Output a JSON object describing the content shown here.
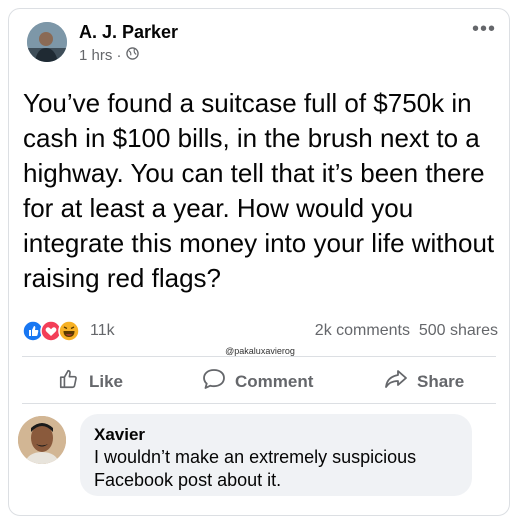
{
  "post": {
    "author": "A. J. Parker",
    "time": "1 hrs ·",
    "audience_icon": "globe-icon",
    "menu_icon": "more-options-icon",
    "text": "You’ve found a suitcase full of $750k in cash in $100 bills, in the brush next to a highway. You can tell that it’s been there for at least a year. How would you integrate this money into your life without raising red flags?"
  },
  "stats": {
    "reaction_icons": [
      "like-reaction-icon",
      "love-reaction-icon",
      "haha-reaction-icon"
    ],
    "reaction_count": "11k",
    "comments_count": "2k comments",
    "shares_count": "500 shares"
  },
  "watermark": "@pakaluxavierog",
  "actions": {
    "like": "Like",
    "comment": "Comment",
    "share": "Share"
  },
  "comment": {
    "author": "Xavier",
    "text": "I wouldn’t make an extremely suspicious Facebook post about it."
  },
  "colors": {
    "secondary_text": "#65676b",
    "like_blue": "#1877f2",
    "love_red": "#f33e58",
    "haha_yellow": "#f7b125",
    "bubble_bg": "#f0f2f5"
  }
}
